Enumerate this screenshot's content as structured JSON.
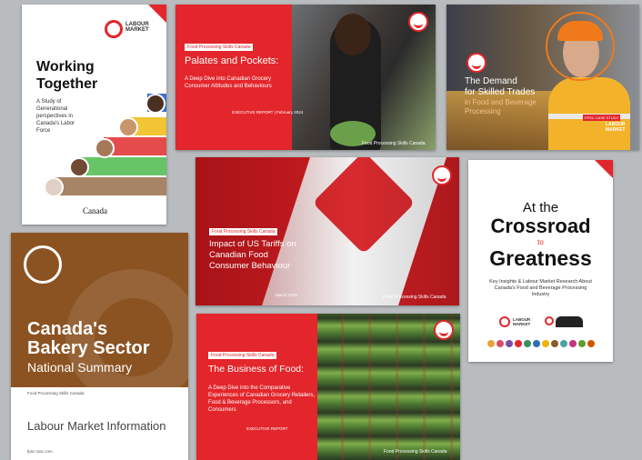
{
  "covers": {
    "working_together": {
      "brand": "LABOUR MARKET",
      "title_line1": "Working",
      "title_line2": "Together",
      "subtitle": "A Study of Generational perspectives in Canada's Labor Force",
      "footer": "Canada"
    },
    "palates": {
      "tag": "Food Processing Skills Canada",
      "title": "Palates and Pockets:",
      "subtitle": "A Deep Dive into Canadian Grocery Consumer Attitudes and Behaviours",
      "meta": "EXECUTIVE REPORT | February 2024",
      "footer": "Food Processing Skills Canada"
    },
    "skilled_trades": {
      "line1": "The Demand",
      "line2": "for Skilled Trades",
      "line3": "in Food and Beverage",
      "line4": "Processing",
      "badge": "FPSC CASE STUDY",
      "brand": "LABOUR MARKET"
    },
    "crossroad": {
      "line1": "At the",
      "line2": "Crossroad",
      "line3": "to",
      "line4": "Greatness",
      "subtitle": "Key Insights & Labour Market Research About Canada's Food and Beverage Processing Industry",
      "brand": "LABOUR MARKET",
      "colors": [
        "#e8a33d",
        "#d84b6a",
        "#7b4fa0",
        "#e3262b",
        "#3a8f5c",
        "#2f6fb5",
        "#f0b400",
        "#8a5a2b",
        "#4aa3a1",
        "#c13584",
        "#5e9c2f",
        "#d35400"
      ]
    },
    "tariffs": {
      "tag": "Food Processing Skills Canada",
      "title": "Impact of US Tariffs on Canadian Food Consumer Behaviour",
      "meta": "March 2025",
      "footer": "Food Processing Skills Canada"
    },
    "bakery": {
      "title_line1": "Canada's",
      "title_line2": "Bakery Sector",
      "subtitle": "National Summary",
      "small": "Food Processing Skills Canada",
      "lower": "Labour Market Information",
      "url": "fpsc-ctac.com"
    },
    "business_food": {
      "tag": "Food Processing Skills Canada",
      "title": "The Business of Food:",
      "subtitle": "A Deep Dive into the Comparative Experiences of Canadian Grocery Retailers, Food & Beverage Processors, and Consumers",
      "meta": "EXECUTIVE REPORT",
      "footer": "Food Processing Skills Canada"
    }
  }
}
